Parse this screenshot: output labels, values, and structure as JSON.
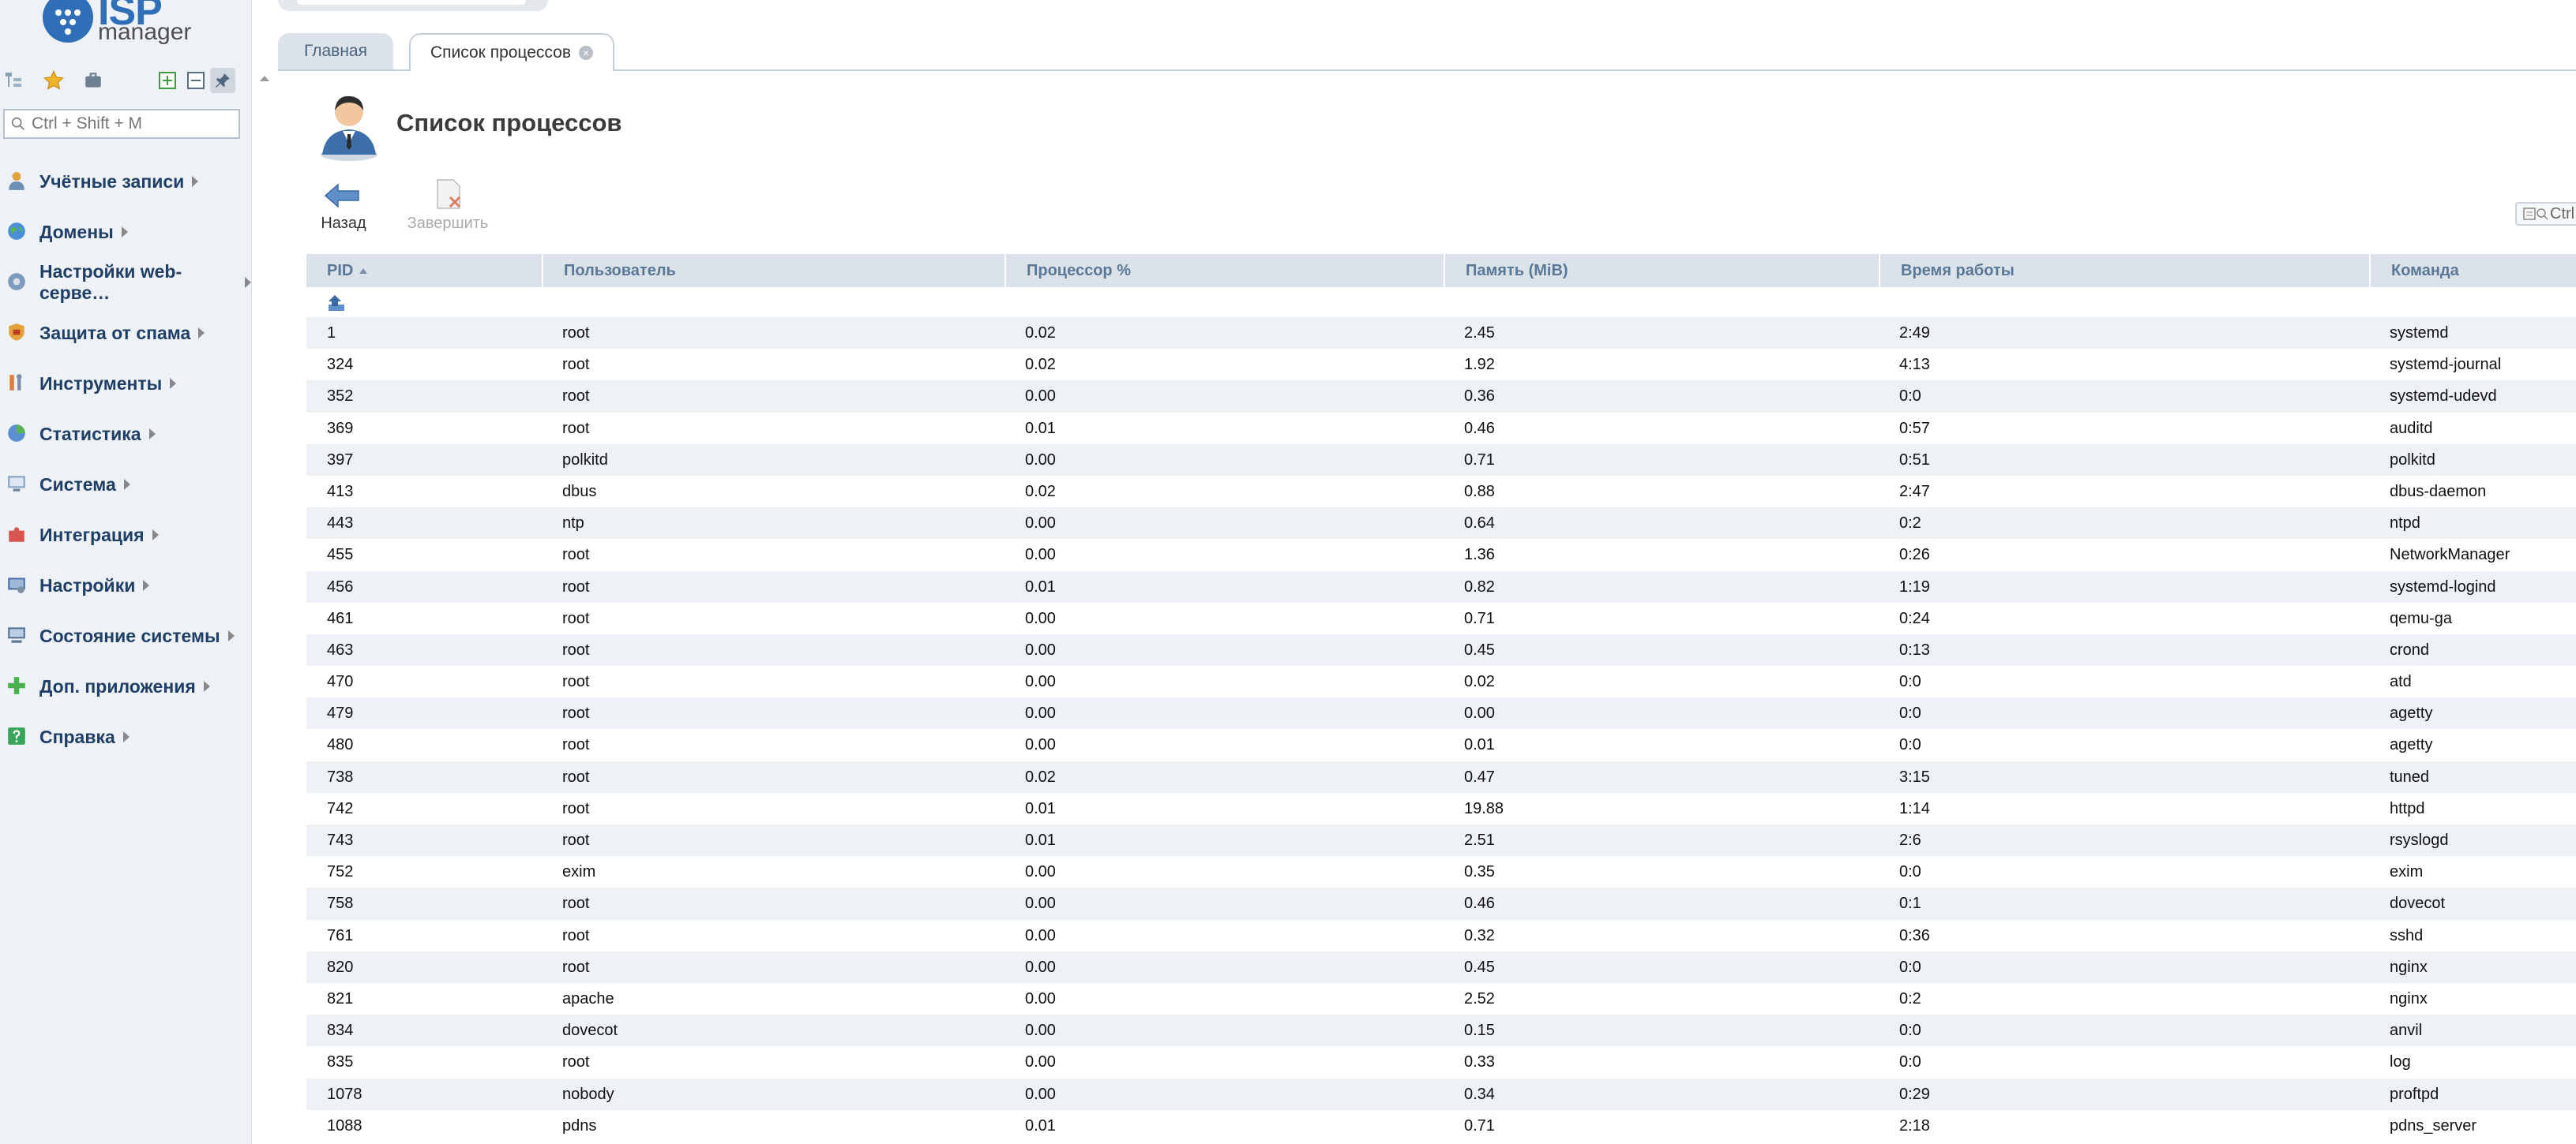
{
  "logo": {
    "brand": "ISP",
    "product": "manager"
  },
  "sidebar": {
    "search_placeholder": "Ctrl + Shift + M",
    "menu": [
      {
        "label": "Учётные записи",
        "icon": "users-icon"
      },
      {
        "label": "Домены",
        "icon": "globe-icon"
      },
      {
        "label": "Настройки web-серве…",
        "icon": "gear-globe-icon"
      },
      {
        "label": "Защита от спама",
        "icon": "shield-icon"
      },
      {
        "label": "Инструменты",
        "icon": "tools-icon"
      },
      {
        "label": "Статистика",
        "icon": "chart-icon"
      },
      {
        "label": "Система",
        "icon": "system-icon"
      },
      {
        "label": "Интеграция",
        "icon": "puzzle-icon"
      },
      {
        "label": "Настройки",
        "icon": "settings-icon"
      },
      {
        "label": "Состояние системы",
        "icon": "monitor-icon"
      },
      {
        "label": "Доп. приложения",
        "icon": "plus-icon"
      },
      {
        "label": "Справка",
        "icon": "help-icon"
      }
    ]
  },
  "tabs": [
    {
      "label": "Главная"
    },
    {
      "label": "Список процессов"
    }
  ],
  "page": {
    "title": "Список процессов",
    "toolbar": {
      "back_label": "Назад",
      "finish_label": "Завершить"
    },
    "filter_label": "Ctrl"
  },
  "table": {
    "columns": [
      "PID",
      "Пользователь",
      "Процессор %",
      "Память (MiB)",
      "Время работы",
      "Команда"
    ],
    "sort_column": "PID",
    "rows": [
      [
        "1",
        "root",
        "0.02",
        "2.45",
        "2:49",
        "systemd"
      ],
      [
        "324",
        "root",
        "0.02",
        "1.92",
        "4:13",
        "systemd-journal"
      ],
      [
        "352",
        "root",
        "0.00",
        "0.36",
        "0:0",
        "systemd-udevd"
      ],
      [
        "369",
        "root",
        "0.01",
        "0.46",
        "0:57",
        "auditd"
      ],
      [
        "397",
        "polkitd",
        "0.00",
        "0.71",
        "0:51",
        "polkitd"
      ],
      [
        "413",
        "dbus",
        "0.02",
        "0.88",
        "2:47",
        "dbus-daemon"
      ],
      [
        "443",
        "ntp",
        "0.00",
        "0.64",
        "0:2",
        "ntpd"
      ],
      [
        "455",
        "root",
        "0.00",
        "1.36",
        "0:26",
        "NetworkManager"
      ],
      [
        "456",
        "root",
        "0.01",
        "0.82",
        "1:19",
        "systemd-logind"
      ],
      [
        "461",
        "root",
        "0.00",
        "0.71",
        "0:24",
        "qemu-ga"
      ],
      [
        "463",
        "root",
        "0.00",
        "0.45",
        "0:13",
        "crond"
      ],
      [
        "470",
        "root",
        "0.00",
        "0.02",
        "0:0",
        "atd"
      ],
      [
        "479",
        "root",
        "0.00",
        "0.00",
        "0:0",
        "agetty"
      ],
      [
        "480",
        "root",
        "0.00",
        "0.01",
        "0:0",
        "agetty"
      ],
      [
        "738",
        "root",
        "0.02",
        "0.47",
        "3:15",
        "tuned"
      ],
      [
        "742",
        "root",
        "0.01",
        "19.88",
        "1:14",
        "httpd"
      ],
      [
        "743",
        "root",
        "0.01",
        "2.51",
        "2:6",
        "rsyslogd"
      ],
      [
        "752",
        "exim",
        "0.00",
        "0.35",
        "0:0",
        "exim"
      ],
      [
        "758",
        "root",
        "0.00",
        "0.46",
        "0:1",
        "dovecot"
      ],
      [
        "761",
        "root",
        "0.00",
        "0.32",
        "0:36",
        "sshd"
      ],
      [
        "820",
        "root",
        "0.00",
        "0.45",
        "0:0",
        "nginx"
      ],
      [
        "821",
        "apache",
        "0.00",
        "2.52",
        "0:2",
        "nginx"
      ],
      [
        "834",
        "dovecot",
        "0.00",
        "0.15",
        "0:0",
        "anvil"
      ],
      [
        "835",
        "root",
        "0.00",
        "0.33",
        "0:0",
        "log"
      ],
      [
        "1078",
        "nobody",
        "0.00",
        "0.34",
        "0:29",
        "proftpd"
      ],
      [
        "1088",
        "pdns",
        "0.01",
        "0.71",
        "2:18",
        "pdns_server"
      ]
    ]
  }
}
